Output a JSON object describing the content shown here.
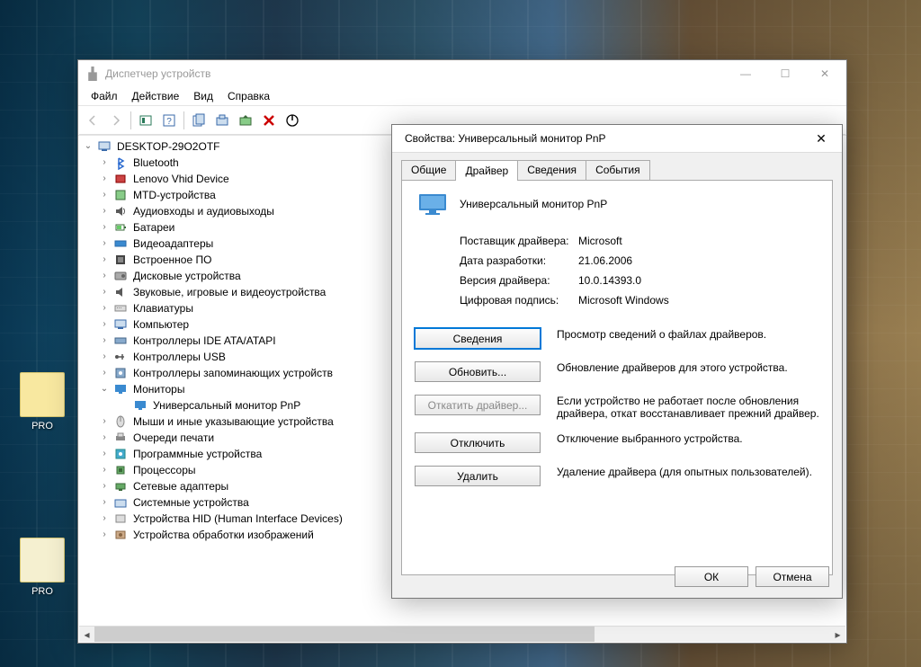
{
  "desktop": {
    "icon1": "PRO",
    "icon2": "PRO"
  },
  "devmgr": {
    "title": "Диспетчер устройств",
    "menu": {
      "file": "Файл",
      "action": "Действие",
      "view": "Вид",
      "help": "Справка"
    },
    "root": "DESKTOP-29O2OTF",
    "nodes": [
      {
        "label": "Bluetooth",
        "icon": "bt"
      },
      {
        "label": "Lenovo Vhid Device",
        "icon": "lenovo"
      },
      {
        "label": "MTD-устройства",
        "icon": "mtd"
      },
      {
        "label": "Аудиовходы и аудиовыходы",
        "icon": "audio"
      },
      {
        "label": "Батареи",
        "icon": "bat"
      },
      {
        "label": "Видеоадаптеры",
        "icon": "video"
      },
      {
        "label": "Встроенное ПО",
        "icon": "fw"
      },
      {
        "label": "Дисковые устройства",
        "icon": "disk"
      },
      {
        "label": "Звуковые, игровые и видеоустройства",
        "icon": "sound"
      },
      {
        "label": "Клавиатуры",
        "icon": "kb"
      },
      {
        "label": "Компьютер",
        "icon": "pc"
      },
      {
        "label": "Контроллеры IDE ATA/ATAPI",
        "icon": "ide"
      },
      {
        "label": "Контроллеры USB",
        "icon": "usb"
      },
      {
        "label": "Контроллеры запоминающих устройств",
        "icon": "stor"
      },
      {
        "label": "Мониторы",
        "icon": "mon",
        "expanded": true,
        "children": [
          {
            "label": "Универсальный монитор PnP",
            "icon": "mon"
          }
        ]
      },
      {
        "label": "Мыши и иные указывающие устройства",
        "icon": "mouse"
      },
      {
        "label": "Очереди печати",
        "icon": "print"
      },
      {
        "label": "Программные устройства",
        "icon": "soft"
      },
      {
        "label": "Процессоры",
        "icon": "cpu"
      },
      {
        "label": "Сетевые адаптеры",
        "icon": "net"
      },
      {
        "label": "Системные устройства",
        "icon": "sys"
      },
      {
        "label": "Устройства HID (Human Interface Devices)",
        "icon": "hid"
      },
      {
        "label": "Устройства обработки изображений",
        "icon": "img"
      }
    ]
  },
  "props": {
    "title": "Свойства: Универсальный монитор PnP",
    "tabs": {
      "general": "Общие",
      "driver": "Драйвер",
      "details": "Сведения",
      "events": "События"
    },
    "device_name": "Универсальный монитор PnP",
    "fields": {
      "provider_k": "Поставщик драйвера:",
      "provider_v": "Microsoft",
      "date_k": "Дата разработки:",
      "date_v": "21.06.2006",
      "version_k": "Версия драйвера:",
      "version_v": "10.0.14393.0",
      "signer_k": "Цифровая подпись:",
      "signer_v": "Microsoft Windows"
    },
    "actions": {
      "details_btn": "Сведения",
      "details_desc": "Просмотр сведений о файлах драйверов.",
      "update_btn": "Обновить...",
      "update_desc": "Обновление драйверов для этого устройства.",
      "rollback_btn": "Откатить драйвер...",
      "rollback_desc": "Если устройство не работает после обновления драйвера, откат восстанавливает прежний драйвер.",
      "disable_btn": "Отключить",
      "disable_desc": "Отключение выбранного устройства.",
      "uninstall_btn": "Удалить",
      "uninstall_desc": "Удаление драйвера (для опытных пользователей)."
    },
    "ok": "ОК",
    "cancel": "Отмена"
  }
}
